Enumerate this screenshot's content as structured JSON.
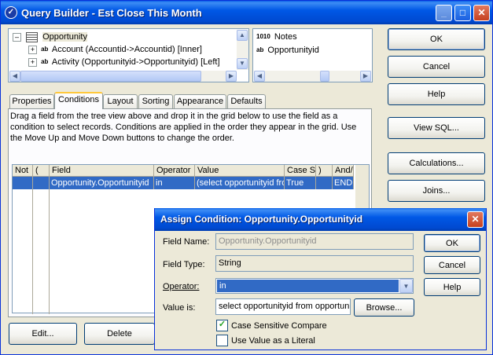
{
  "window": {
    "title": "Query Builder - Est Close This Month",
    "min_glyph": "_",
    "max_glyph": "□",
    "close_glyph": "✕"
  },
  "tree": {
    "root": {
      "label": "Opportunity",
      "expander": "–"
    },
    "children": [
      {
        "label": "Account (Accountid->Accountid) [Inner]",
        "expander": "+",
        "icon": "ab"
      },
      {
        "label": "Activity (Opportunityid->Opportunityid) [Left]",
        "expander": "+",
        "icon": "ab"
      }
    ]
  },
  "fields": {
    "items": [
      {
        "label": "Notes",
        "icon": "1010"
      },
      {
        "label": "Opportunityid",
        "icon": "ab"
      }
    ]
  },
  "right_buttons": {
    "ok": "OK",
    "cancel": "Cancel",
    "help": "Help",
    "view_sql": "View SQL...",
    "calculations": "Calculations...",
    "joins": "Joins..."
  },
  "tabs": [
    "Properties",
    "Conditions",
    "Layout",
    "Sorting",
    "Appearance",
    "Defaults"
  ],
  "conditions": {
    "instructions": "Drag a field from the tree view above and drop it in the grid below to use the field as a condition to select records.  Conditions are applied in the order they appear in the grid.  Use the Move Up and Move Down buttons to change the order.",
    "columns": [
      "Not",
      "(",
      "Field",
      "Operator",
      "Value",
      "Case S",
      ")",
      "And/("
    ],
    "row": {
      "not": "",
      "open": "",
      "field": "Opportunity.Opportunityid",
      "operator": "in",
      "value": "(select opportunityid from",
      "case": "True",
      "close": "",
      "andor": "END"
    },
    "edit_label": "Edit...",
    "delete_label": "Delete"
  },
  "dialog": {
    "title": "Assign Condition: Opportunity.Opportunityid",
    "close_glyph": "✕",
    "field_name_label": "Field Name:",
    "field_name_value": "Opportunity.Opportunityid",
    "field_type_label": "Field Type:",
    "field_type_value": "String",
    "operator_label": "Operator:",
    "operator_value": "in",
    "value_label": "Value is:",
    "value_value": "select opportunityid from opportunit",
    "browse_label": "Browse...",
    "case_sensitive_label": "Case Sensitive Compare",
    "case_sensitive_checked": true,
    "literal_label": "Use Value as a Literal",
    "literal_checked": false,
    "ok_label": "OK",
    "cancel_label": "Cancel",
    "help_label": "Help"
  }
}
